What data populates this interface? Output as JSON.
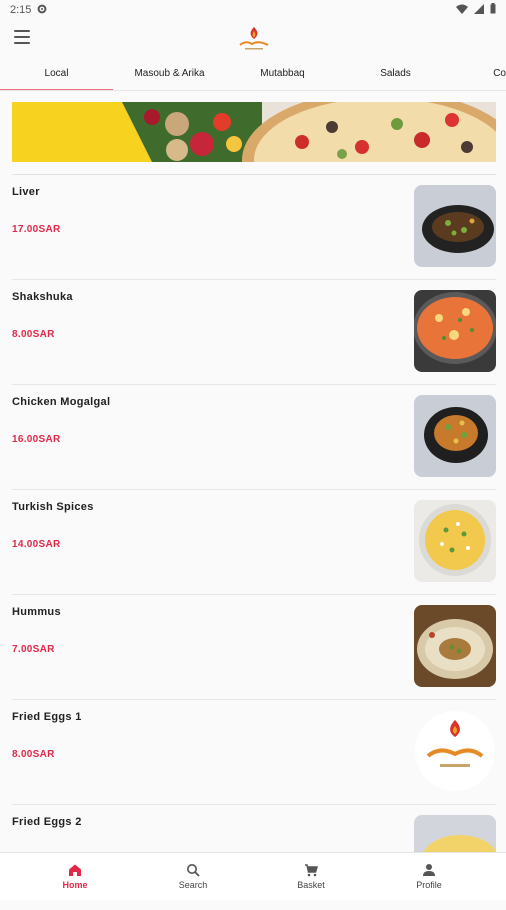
{
  "status": {
    "time": "2:15"
  },
  "appbar": {
    "menu_icon": "menu-icon",
    "logo_icon": "flame-logo-icon"
  },
  "tabs": [
    {
      "label": "Local",
      "active": true
    },
    {
      "label": "Masoub & Arika",
      "active": false
    },
    {
      "label": "Mutabbaq",
      "active": false
    },
    {
      "label": "Salads",
      "active": false
    },
    {
      "label": "Cold D",
      "active": false
    }
  ],
  "items": [
    {
      "name": "Liver",
      "price": "17.00SAR"
    },
    {
      "name": "Shakshuka",
      "price": "8.00SAR"
    },
    {
      "name": "Chicken Mogalgal",
      "price": "16.00SAR"
    },
    {
      "name": "Turkish Spices",
      "price": "14.00SAR"
    },
    {
      "name": "Hummus",
      "price": "7.00SAR"
    },
    {
      "name": "Fried Eggs 1",
      "price": "8.00SAR"
    },
    {
      "name": "Fried Eggs 2",
      "price": ""
    }
  ],
  "bottom_nav": [
    {
      "label": "Home",
      "icon": "home-icon",
      "active": true
    },
    {
      "label": "Search",
      "icon": "search-icon",
      "active": false
    },
    {
      "label": "Basket",
      "icon": "cart-icon",
      "active": false
    },
    {
      "label": "Profile",
      "icon": "person-icon",
      "active": false
    }
  ],
  "colors": {
    "accent": "#e0284a",
    "tab_indicator": "#f16d7b",
    "banner_yellow": "#f7d21e"
  }
}
